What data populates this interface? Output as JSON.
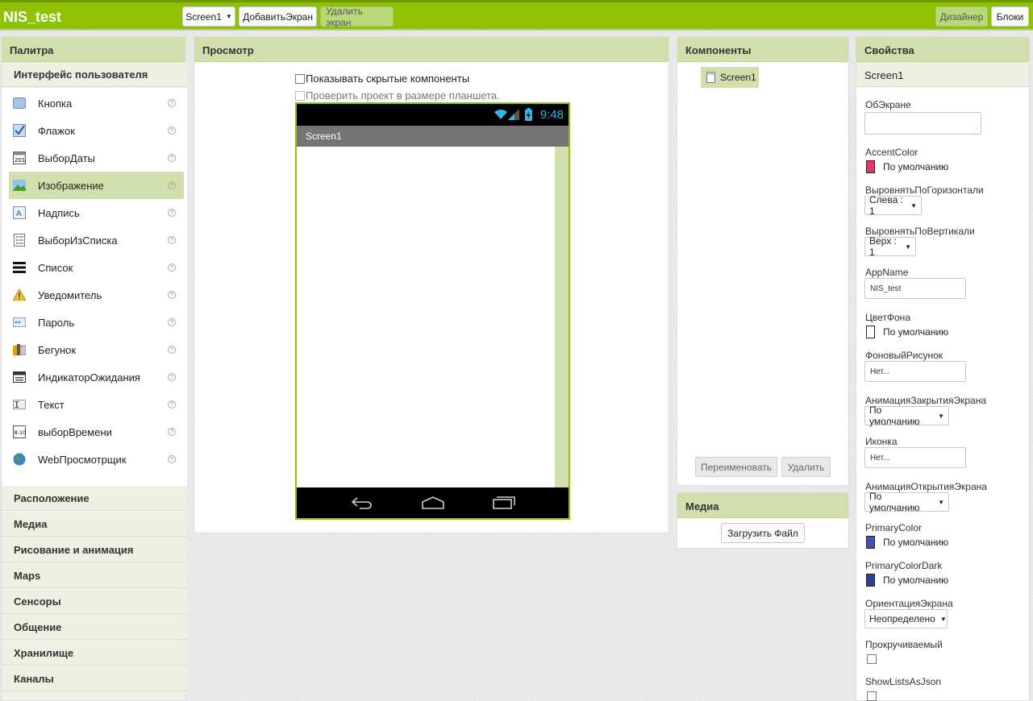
{
  "topbar": {
    "app_title": "NIS_test",
    "screen_select": "Screen1",
    "add_screen": "ДобавитьЭкран",
    "remove_screen": "Удалить экран",
    "designer": "Дизайнер",
    "blocks": "Блоки",
    "color": "#8fc202"
  },
  "palette": {
    "title": "Палитра",
    "category": "Интерфейс пользователя",
    "items": [
      {
        "label": "Кнопка",
        "icon": "button-icon"
      },
      {
        "label": "Флажок",
        "icon": "checkbox-icon"
      },
      {
        "label": "ВыборДаты",
        "icon": "datepicker-icon"
      },
      {
        "label": "Изображение",
        "icon": "image-icon",
        "selected": true
      },
      {
        "label": "Надпись",
        "icon": "label-icon"
      },
      {
        "label": "ВыборИзСписка",
        "icon": "listpicker-icon"
      },
      {
        "label": "Список",
        "icon": "listview-icon"
      },
      {
        "label": "Уведомитель",
        "icon": "notifier-icon"
      },
      {
        "label": "Пароль",
        "icon": "password-icon"
      },
      {
        "label": "Бегунок",
        "icon": "slider-icon"
      },
      {
        "label": "ИндикаторОжидания",
        "icon": "spinner-icon"
      },
      {
        "label": "Текст",
        "icon": "textbox-icon"
      },
      {
        "label": "выборВремени",
        "icon": "timepicker-icon"
      },
      {
        "label": "WebПросмотрщик",
        "icon": "webviewer-icon"
      }
    ],
    "categories": [
      "Расположение",
      "Медиа",
      "Рисование и анимация",
      "Maps",
      "Сенсоры",
      "Общение",
      "Хранилище",
      "Каналы"
    ]
  },
  "viewer": {
    "title": "Просмотр",
    "show_hidden": "Показывать скрытые компоненты",
    "tablet_preview": "Проверить проект в размере планшета.",
    "phone_time": "9:48",
    "phone_title": "Screen1"
  },
  "components": {
    "title": "Компоненты",
    "tree_root": "Screen1",
    "rename": "Переименовать",
    "delete": "Удалить"
  },
  "media": {
    "title": "Медиа",
    "upload": "Загрузить Файл"
  },
  "properties": {
    "title": "Свойства",
    "component": "Screen1",
    "about_screen": "ОбЭкране",
    "accent_color": {
      "label": "AccentColor",
      "value": "По умолчанию",
      "color": "#ee3366"
    },
    "align_horizontal": {
      "label": "ВыровнятьПоГоризонтали",
      "value": "Слева : 1"
    },
    "align_vertical": {
      "label": "ВыровнятьПоВертикали",
      "value": "Верх : 1"
    },
    "app_name": {
      "label": "AppName",
      "value": "NIS_test"
    },
    "background_color": {
      "label": "ЦветФона",
      "value": "По умолчанию",
      "color": "#ffffff"
    },
    "background_image": {
      "label": "ФоновыйРисунок",
      "value": "Нет..."
    },
    "close_animation": {
      "label": "АнимацияЗакрытияЭкрана",
      "value": "По умолчанию"
    },
    "icon": {
      "label": "Иконка",
      "value": "Нет..."
    },
    "open_animation": {
      "label": "АнимацияОткрытияЭкрана",
      "value": "По умолчанию"
    },
    "primary_color": {
      "label": "PrimaryColor",
      "value": "По умолчанию",
      "color": "#3f51b5"
    },
    "primary_color_dark": {
      "label": "PrimaryColorDark",
      "value": "По умолчанию",
      "color": "#303f9f"
    },
    "orientation": {
      "label": "ОриентацияЭкрана",
      "value": "Неопределено"
    },
    "scrollable": {
      "label": "Прокручиваемый"
    },
    "show_lists_as_json": {
      "label": "ShowListsAsJson"
    }
  }
}
